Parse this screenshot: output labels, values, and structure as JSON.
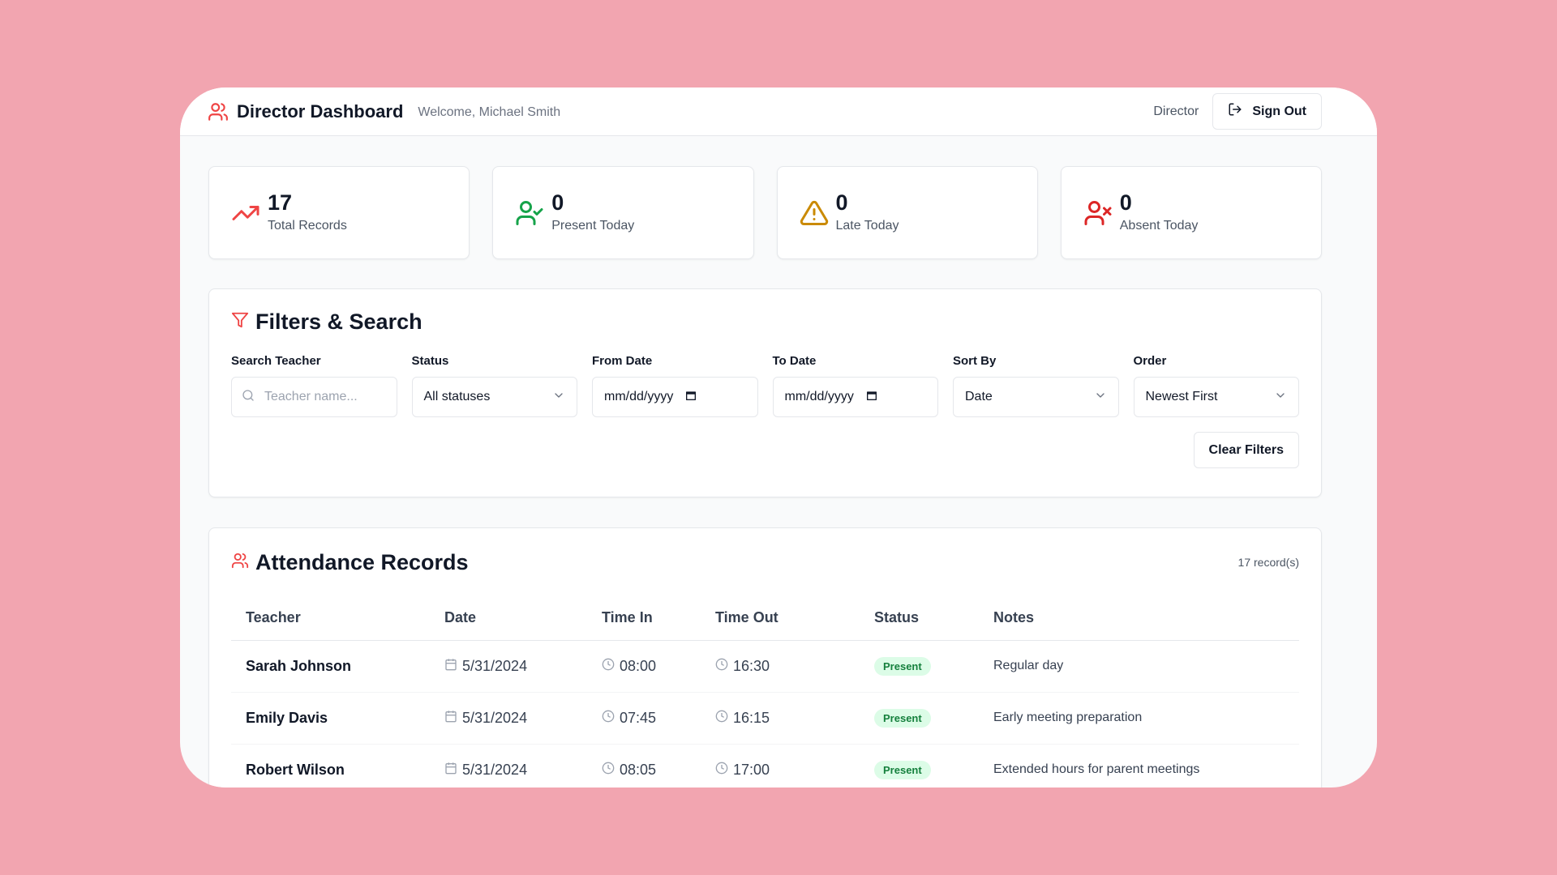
{
  "header": {
    "title": "Director Dashboard",
    "welcome": "Welcome, Michael Smith",
    "role": "Director",
    "sign_out_label": "Sign Out"
  },
  "stats": [
    {
      "value": "17",
      "label": "Total Records",
      "icon": "trending-up-icon",
      "color": "#ef4444"
    },
    {
      "value": "0",
      "label": "Present Today",
      "icon": "user-check-icon",
      "color": "#16a34a"
    },
    {
      "value": "0",
      "label": "Late Today",
      "icon": "alert-triangle-icon",
      "color": "#ca8a04"
    },
    {
      "value": "0",
      "label": "Absent Today",
      "icon": "user-x-icon",
      "color": "#dc2626"
    }
  ],
  "filters": {
    "title": "Filters & Search",
    "search_label": "Search Teacher",
    "search_placeholder": "Teacher name...",
    "status_label": "Status",
    "status_value": "All statuses",
    "from_label": "From Date",
    "from_value": "mm/dd/yyyy",
    "to_label": "To Date",
    "to_value": "mm/dd/yyyy",
    "sort_label": "Sort By",
    "sort_value": "Date",
    "order_label": "Order",
    "order_value": "Newest First",
    "clear_label": "Clear Filters"
  },
  "records": {
    "title": "Attendance Records",
    "count": "17 record(s)",
    "columns": [
      "Teacher",
      "Date",
      "Time In",
      "Time Out",
      "Status",
      "Notes"
    ],
    "rows": [
      {
        "teacher": "Sarah Johnson",
        "date": "5/31/2024",
        "time_in": "08:00",
        "time_out": "16:30",
        "status": "Present",
        "notes": "Regular day"
      },
      {
        "teacher": "Emily Davis",
        "date": "5/31/2024",
        "time_in": "07:45",
        "time_out": "16:15",
        "status": "Present",
        "notes": "Early meeting preparation"
      },
      {
        "teacher": "Robert Wilson",
        "date": "5/31/2024",
        "time_in": "08:05",
        "time_out": "17:00",
        "status": "Present",
        "notes": "Extended hours for parent meetings"
      }
    ]
  },
  "colors": {
    "accent": "#ef4444",
    "background": "#f2a5b0",
    "present_badge_bg": "#dcfce7",
    "present_badge_text": "#15803d"
  }
}
